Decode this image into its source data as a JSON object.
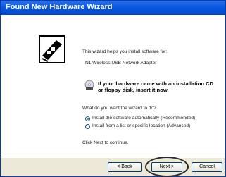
{
  "window": {
    "title": "Found New Hardware Wizard"
  },
  "side_panel": {
    "icon": "hardware-card-icon"
  },
  "content": {
    "intro": "This wizard helps you install software for:",
    "device_name": "N1 Wireless USB Network Adapter",
    "cd_icon": "cd-floppy-icon",
    "cd_prompt": "If your hardware came with an installation CD or floppy disk, insert it now.",
    "question": "What do you want the wizard to do?",
    "options": [
      {
        "label": "Install the software automatically (Recommended)",
        "selected": true
      },
      {
        "label": "Install from a list or specific location (Advanced)",
        "selected": false
      }
    ],
    "continue_hint": "Click Next to continue."
  },
  "buttons": {
    "back": "< Back",
    "next": "Next >",
    "cancel": "Cancel"
  },
  "colors": {
    "titlebar": "#0a58e0",
    "window_bg": "#ece9d8",
    "highlight": "#2b2b2b"
  }
}
